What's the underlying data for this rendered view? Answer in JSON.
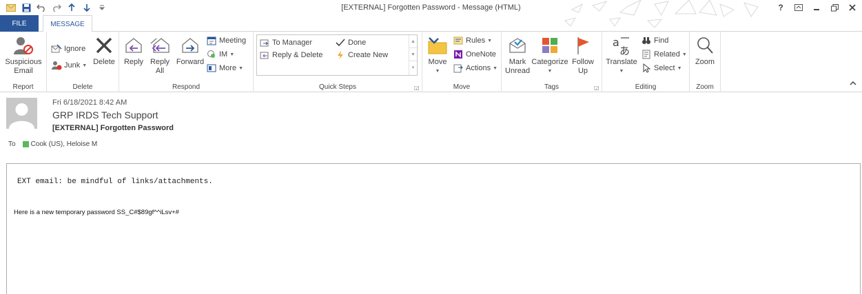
{
  "window": {
    "title": "[EXTERNAL] Forgotten Password - Message (HTML)",
    "help_label": "?"
  },
  "tabs": [
    {
      "label": "FILE"
    },
    {
      "label": "MESSAGE"
    }
  ],
  "ribbon": {
    "groups": {
      "report": {
        "label": "Report",
        "suspicious_email": "Suspicious Email"
      },
      "delete": {
        "label": "Delete",
        "ignore": "Ignore",
        "junk": "Junk",
        "delete": "Delete"
      },
      "respond": {
        "label": "Respond",
        "reply": "Reply",
        "reply_all": "Reply All",
        "forward": "Forward",
        "meeting": "Meeting",
        "im": "IM",
        "more": "More"
      },
      "quick_steps": {
        "label": "Quick Steps",
        "to_manager": "To Manager",
        "done": "Done",
        "reply_delete": "Reply & Delete",
        "create_new": "Create New"
      },
      "move": {
        "label": "Move",
        "move": "Move",
        "rules": "Rules",
        "onenote": "OneNote",
        "actions": "Actions"
      },
      "tags": {
        "label": "Tags",
        "mark_unread": "Mark Unread",
        "categorize": "Categorize",
        "follow_up": "Follow Up"
      },
      "editing": {
        "label": "Editing",
        "translate": "Translate",
        "find": "Find",
        "related": "Related",
        "select": "Select"
      },
      "zoom": {
        "label": "Zoom",
        "zoom": "Zoom"
      }
    }
  },
  "header": {
    "date": "Fri 6/18/2021 8:42 AM",
    "sender": "GRP IRDS Tech Support",
    "subject": "[EXTERNAL] Forgotten Password",
    "to_label": "To",
    "recipient": "Cook (US), Heloise M"
  },
  "body": {
    "banner": "EXT email: be mindful of links/attachments.",
    "text": "Here is a new temporary password SS_C#$89gf^^iLsv+#"
  },
  "colors": {
    "file_tab": "#2b579a",
    "presence": "#5cb85c",
    "follow_up_flag": "#e3572e"
  }
}
